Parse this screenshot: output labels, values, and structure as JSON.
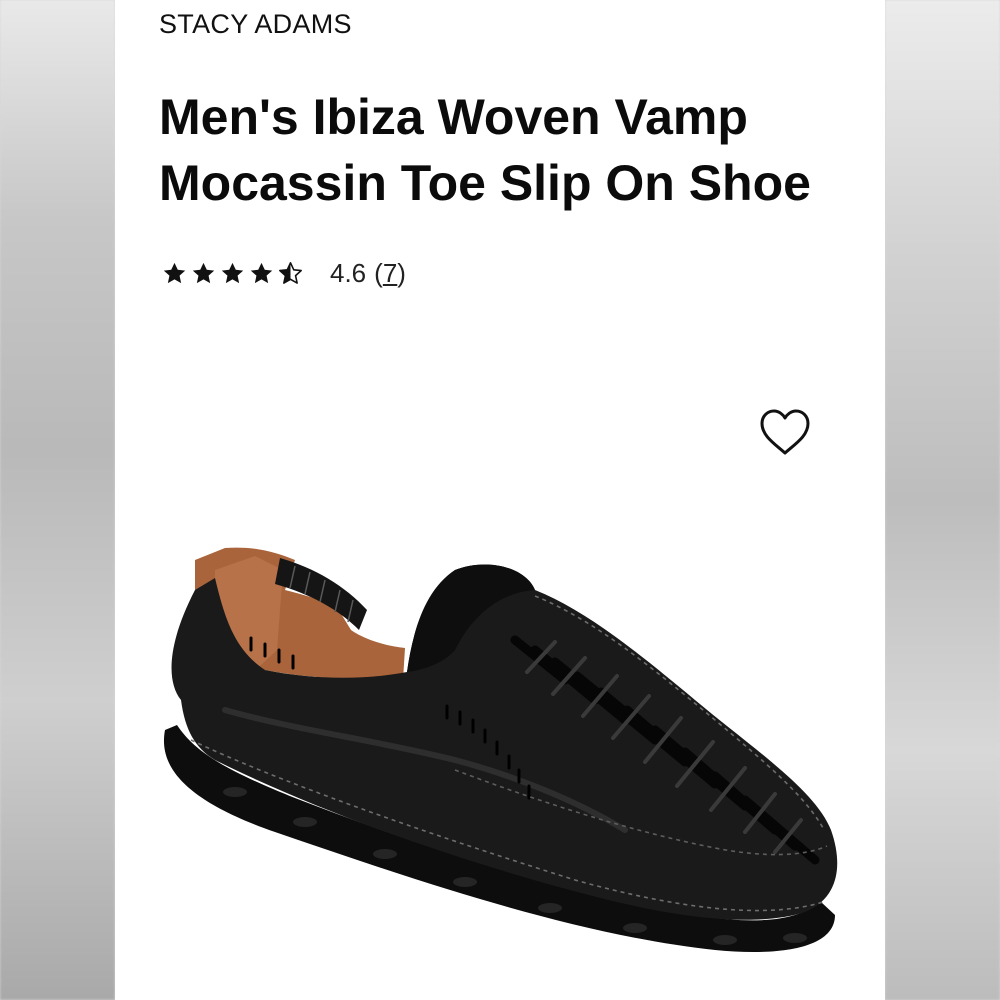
{
  "product": {
    "brand": "STACY ADAMS",
    "title": "Men's Ibiza Woven Vamp Mocassin Toe Slip On Shoe",
    "rating": {
      "stars": 4.5,
      "max_stars": 5,
      "score": "4.6",
      "count_open": "(",
      "count": "7",
      "count_close": ")"
    },
    "wishlist_icon": "heart-outline-icon",
    "image": {
      "subject": "shoe-image",
      "primary_color": "#141414",
      "lining_color": "#a9643b"
    }
  }
}
